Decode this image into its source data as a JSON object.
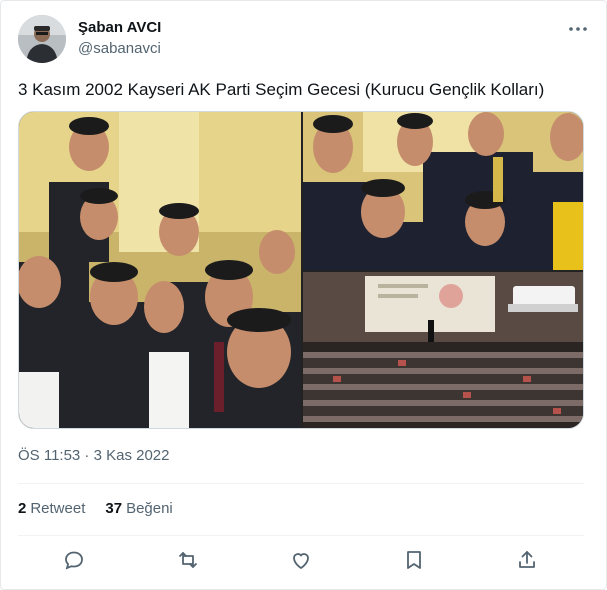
{
  "author": {
    "name": "Şaban AVCI",
    "handle": "@sabanavci",
    "avatar_icon": "person-avatar"
  },
  "tweet": {
    "text": "3 Kasım 2002 Kayseri AK Parti Seçim Gecesi (Kurucu Gençlik Kolları)",
    "timestamp": "ÖS 11:53 · 3 Kas 2022"
  },
  "media": {
    "count": 3,
    "photos": [
      {
        "icon": "group-photo-men-indoor"
      },
      {
        "icon": "group-photo-young-men"
      },
      {
        "icon": "audience-hall-presentation"
      }
    ]
  },
  "stats": {
    "retweets_count": "2",
    "retweets_label": "Retweet",
    "likes_count": "37",
    "likes_label": "Beğeni"
  },
  "actions": [
    "reply-icon",
    "retweet-icon",
    "like-icon",
    "bookmark-icon",
    "share-icon"
  ],
  "colors": {
    "text_primary": "#0f1419",
    "text_secondary": "#536471",
    "border": "#eff3f4"
  }
}
